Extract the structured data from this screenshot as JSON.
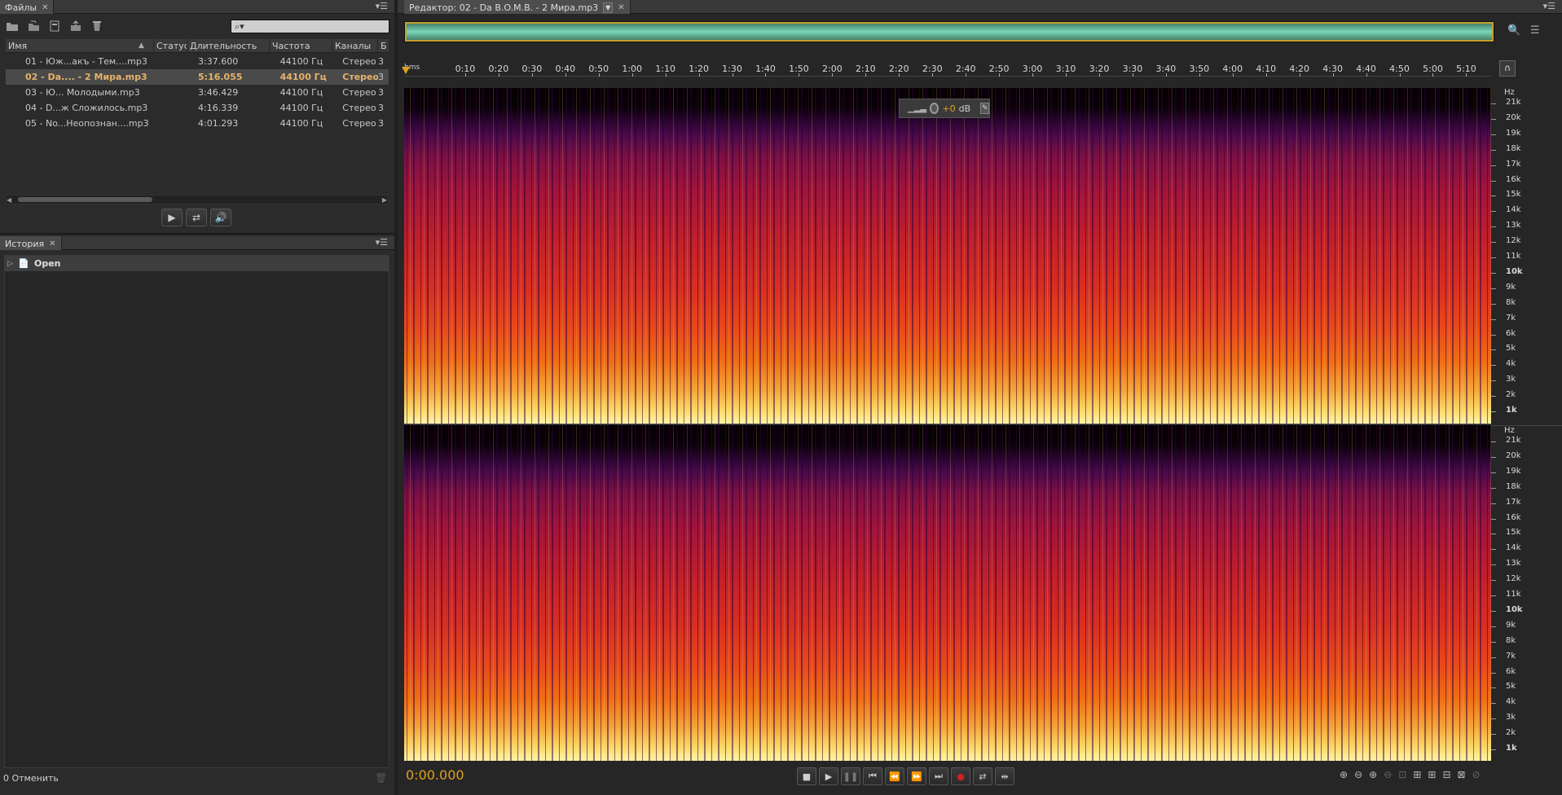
{
  "files_panel": {
    "tab_label": "Файлы",
    "search_placeholder": "",
    "columns": [
      "Имя",
      "Статус",
      "Длительность",
      "Частота",
      "Каналы",
      "Б"
    ],
    "rows": [
      {
        "name": "01 - Юж...акъ - Тем....mp3",
        "status": "",
        "duration": "3:37.600",
        "freq": "44100 Гц",
        "channels": "Стерео",
        "b": "3"
      },
      {
        "name": "02 - Da.... - 2 Мира.mp3",
        "status": "",
        "duration": "5:16.055",
        "freq": "44100 Гц",
        "channels": "Стерео",
        "b": "3",
        "selected": true
      },
      {
        "name": "03 - Ю... Молодыми.mp3",
        "status": "",
        "duration": "3:46.429",
        "freq": "44100 Гц",
        "channels": "Стерео",
        "b": "3"
      },
      {
        "name": "04 - D...ж Сложилось.mp3",
        "status": "",
        "duration": "4:16.339",
        "freq": "44100 Гц",
        "channels": "Стерео",
        "b": "3"
      },
      {
        "name": "05 - No...Неопознан....mp3",
        "status": "",
        "duration": "4:01.293",
        "freq": "44100 Гц",
        "channels": "Стерео",
        "b": "3"
      }
    ],
    "toolbar_icons": [
      "open-folder-icon",
      "import-icon",
      "new-file-icon",
      "export-icon",
      "delete-icon"
    ],
    "footer_buttons": [
      "play-icon",
      "loop-icon",
      "auto-play-icon"
    ]
  },
  "history_panel": {
    "tab_label": "История",
    "items": [
      "Open"
    ],
    "status": "0 Отменить"
  },
  "editor": {
    "tab_label": "Редактор: 02 - Da B.O.M.B. - 2 Мира.mp3",
    "ruler_unit": "hms",
    "ruler_ticks": [
      "0:10",
      "0:20",
      "0:30",
      "0:40",
      "0:50",
      "1:00",
      "1:10",
      "1:20",
      "1:30",
      "1:40",
      "1:50",
      "2:00",
      "2:10",
      "2:20",
      "2:30",
      "2:40",
      "2:50",
      "3:00",
      "3:10",
      "3:20",
      "3:30",
      "3:40",
      "3:50",
      "4:00",
      "4:10",
      "4:20",
      "4:30",
      "4:40",
      "4:50",
      "5:00",
      "5:10"
    ],
    "hz_unit": "Hz",
    "hz_labels": [
      "21k",
      "20k",
      "19k",
      "18k",
      "17k",
      "16k",
      "15k",
      "14k",
      "13k",
      "12k",
      "11k",
      "10k",
      "9k",
      "8k",
      "7k",
      "6k",
      "5k",
      "4k",
      "3k",
      "2k",
      "1k"
    ],
    "hud_gain": "+0",
    "hud_unit": "dB",
    "time_display": "0:00.000",
    "colors": {
      "accent_time": "#e0a020",
      "waveform": "#6ad2b0"
    }
  }
}
